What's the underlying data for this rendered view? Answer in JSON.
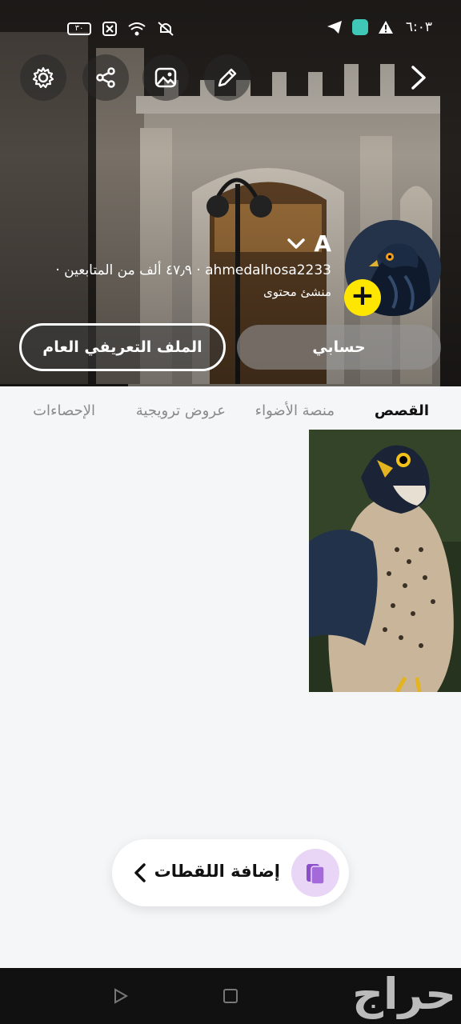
{
  "status_bar": {
    "time": "٦:٠٣",
    "battery": "٣٠"
  },
  "header": {
    "icons": [
      "settings-icon",
      "share-icon",
      "image-icon",
      "edit-icon",
      "forward-chevron-icon"
    ]
  },
  "profile": {
    "display_name": "A",
    "followers_line": "ahmedalhosa2233 · ٤٧٫٩ ألف من المتابعين ·",
    "role": "منشئ محتوى",
    "add_icon": "+",
    "public_profile_button": "الملف التعريفي العام",
    "account_button": "حسابي"
  },
  "tabs": {
    "stories": "القصص",
    "spotlight": "منصة الأضواء",
    "promotions": "عروض ترويجية",
    "statistics": "الإحصاءات"
  },
  "add_snaps": {
    "label": "إضافة اللقطات"
  },
  "watermark": "حراج"
}
